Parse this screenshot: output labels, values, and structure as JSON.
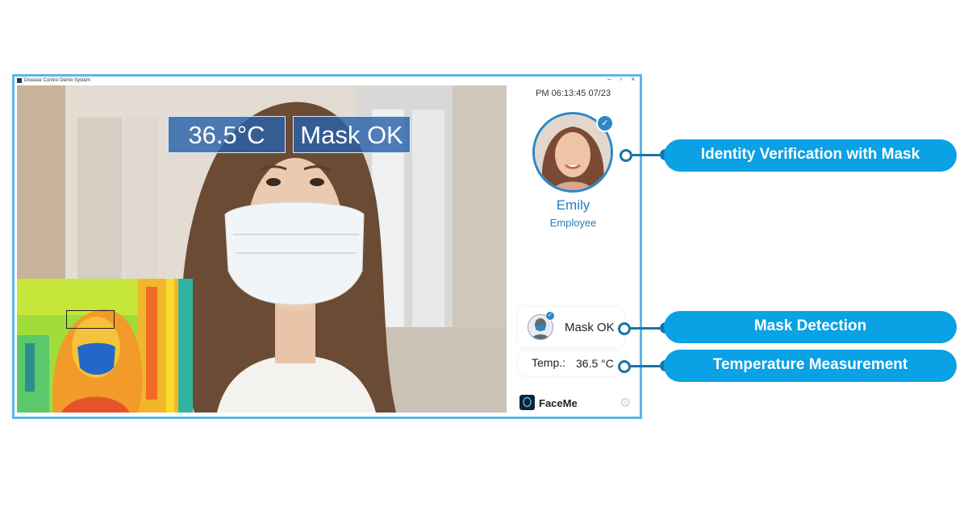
{
  "window": {
    "title": "Disease Control Demo System",
    "controls": {
      "minimize": "–",
      "maximize": "▫",
      "close": "×"
    }
  },
  "camera": {
    "overlay_temperature": "36.5°C",
    "overlay_mask": "Mask OK"
  },
  "panel": {
    "clock": "PM 06:13:45 07/23",
    "user_name": "Emily",
    "user_role": "Employee",
    "mask_status": "Mask OK",
    "temp_label": "Temp.:",
    "temp_value": "36.5 °C",
    "brand_name": "FaceMe",
    "settings_icon": "gear-icon"
  },
  "callouts": [
    {
      "label": "Identity Verification with Mask"
    },
    {
      "label": "Mask Detection"
    },
    {
      "label": "Temperature Measurement"
    }
  ],
  "colors": {
    "window_border": "#5cb6e4",
    "overlay_bg": "#2961aa",
    "accent_blue": "#2b88c8",
    "callout_pill": "#0aa1e5",
    "connector": "#1b73a8"
  }
}
